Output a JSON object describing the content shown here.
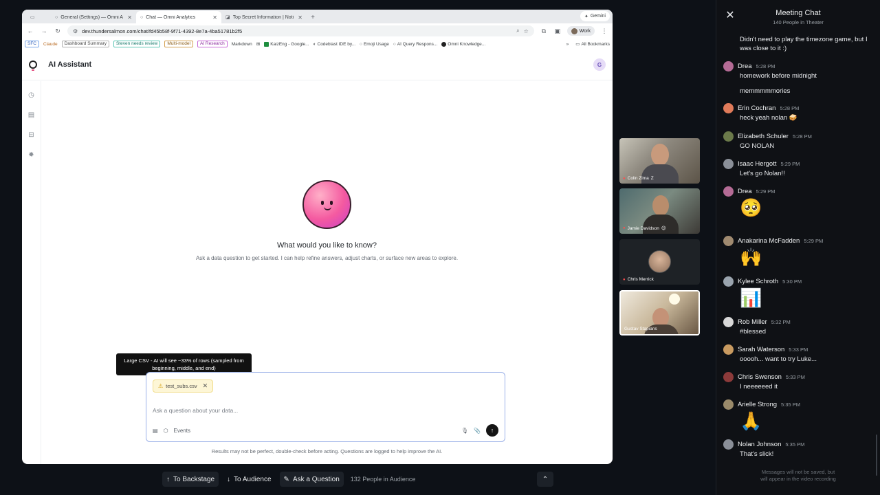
{
  "browser": {
    "tabs": [
      {
        "label": "General (Settings) — Omni A",
        "icon": "omni-icon"
      },
      {
        "label": "Chat — Omni Analytics",
        "icon": "omni-icon",
        "active": true
      },
      {
        "label": "Top Secret Information | Noti",
        "icon": "notion-icon"
      }
    ],
    "gemini_label": "Gemini",
    "url": "dev.thundersalmon.com/chat/fd45b58f-9f71-4392-8e7a-4ba51781b2f5",
    "profile_label": "Work",
    "bookmarks": {
      "sfc": "SFC",
      "claude": "Claude",
      "dashboard_summary": "Dashboard Summary",
      "steven": "Steven needs review",
      "multi_model": "Multi-model",
      "ai_research": "AI Research",
      "markdown": "Markdown",
      "kaizeng": "KaizEng - Google...",
      "codeblast": "Codeblast IDE by...",
      "emoji_usage": "Emoji Usage",
      "ai_query": "AI Query Respons...",
      "omni_knowledge": "Omni Knowledge...",
      "more": "»",
      "all_bookmarks": "All Bookmarks"
    }
  },
  "app": {
    "title": "AI Assistant",
    "user_initial": "G",
    "hero_question": "What would you like to know?",
    "hero_sub": "Ask a data question to get started. I can help refine answers, adjust charts, or surface new areas to explore.",
    "tooltip": "Large CSV - AI will see ~33% of rows (sampled from beginning, middle, and end)",
    "attachment_name": "test_subs.csv",
    "input_placeholder": "Ask a question about your data...",
    "topic_label": "Events",
    "disclaimer": "Results may not be perfect, double-check before acting. Questions are logged to help improve the AI."
  },
  "video_tiles": [
    {
      "name": "Colin Zima",
      "suffix": "Z"
    },
    {
      "name": "Jamie Davidson"
    },
    {
      "name": "Chris Merrick"
    },
    {
      "name": "Gustav Stapians"
    }
  ],
  "controls": {
    "backstage": "To Backstage",
    "audience": "To Audience",
    "ask": "Ask a Question",
    "audience_count": "132 People in Audience"
  },
  "chat": {
    "title": "Meeting Chat",
    "subtitle": "140 People in Theater",
    "messages": [
      {
        "name": "",
        "time": "",
        "text": "Didn't need to play the timezone game, but I was close to it :)"
      },
      {
        "name": "Drea",
        "time": "5:28 PM",
        "text": "homework before midnight"
      },
      {
        "name": "",
        "time": "",
        "text": "memmmmmories"
      },
      {
        "name": "Erin Cochran",
        "time": "5:28 PM",
        "text": "heck yeah nolan"
      },
      {
        "name": "Elizabeth Schuler",
        "time": "5:28 PM",
        "text": "GO NOLAN"
      },
      {
        "name": "Isaac Hergott",
        "time": "5:29 PM",
        "text": "Let's go Nolan!!"
      },
      {
        "name": "Drea",
        "time": "5:29 PM",
        "emoji": "🥺"
      },
      {
        "name": "Anakarina McFadden",
        "time": "5:29 PM",
        "emoji": "🙌"
      },
      {
        "name": "Kylee Schroth",
        "time": "5:30 PM",
        "emoji": "📊"
      },
      {
        "name": "Rob Miller",
        "time": "5:32 PM",
        "text": "#blessed"
      },
      {
        "name": "Sarah Waterson",
        "time": "5:33 PM",
        "text": "ooooh... want to try Luke..."
      },
      {
        "name": "Chris Swenson",
        "time": "5:33 PM",
        "text": "I neeeeeed it"
      },
      {
        "name": "Arielle Strong",
        "time": "5:35 PM",
        "emoji": "🙏"
      },
      {
        "name": "Nolan Johnson",
        "time": "5:35 PM",
        "text": "That's slick!"
      }
    ],
    "footer_line1": "Messages will not be saved, but",
    "footer_line2": "will appear in the video recording"
  },
  "colors": {
    "accent": "#e2467a",
    "chat_bg": "#0f1115",
    "composer_border": "#9ab0e8"
  }
}
